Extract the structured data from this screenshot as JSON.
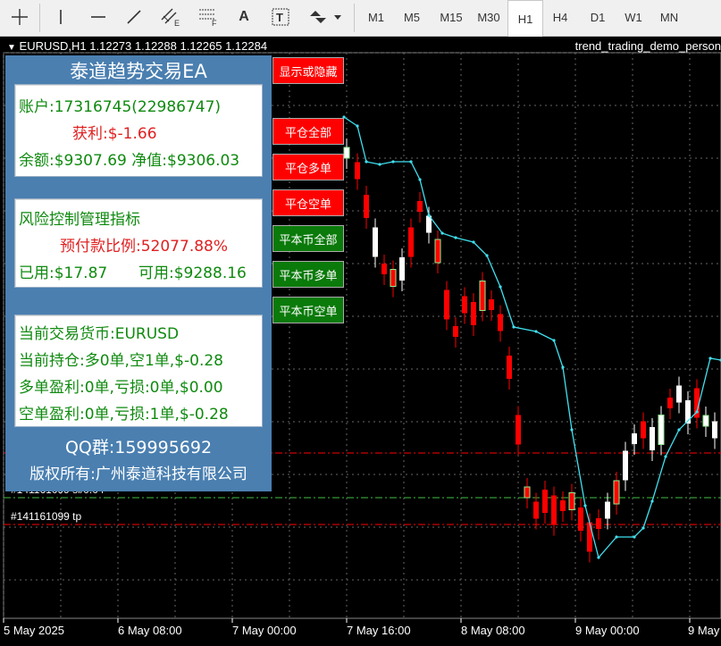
{
  "toolbar": {
    "timeframes": [
      "M1",
      "M5",
      "M15",
      "M30",
      "H1",
      "H4",
      "D1",
      "W1",
      "MN"
    ],
    "active_timeframe": "H1",
    "tool_text": "A",
    "tool_textbox": "T"
  },
  "chart": {
    "title": "EURUSD,H1  1.12273 1.12288 1.12265 1.12284",
    "ea_name": "trend_trading_demo_person",
    "sl_label": "#141161099 sl/0.04",
    "tp_label": "#141161099 tp",
    "x_labels": [
      "5 May 2025",
      "6 May 08:00",
      "7 May 00:00",
      "7 May 16:00",
      "8 May 08:00",
      "9 May 00:00",
      "9 May"
    ],
    "colors": {
      "bull": "#ffffff",
      "bear": "#ff0000",
      "doji": "#90ee90",
      "trail": "#40e0f0",
      "stop": "#ff0000",
      "grid": "#666666"
    }
  },
  "panel": {
    "title": "泰道趋势交易EA",
    "account_label": "账户:",
    "account_value": "17316745(22986747)",
    "profit_label": "获利:",
    "profit_value": "$-1.66",
    "balance_label": "余额:",
    "balance_value": "$9307.69",
    "equity_label": "净值:",
    "equity_value": "$9306.03",
    "risk_title": "风险控制管理指标",
    "margin_ratio_label": "预付款比例:",
    "margin_ratio_value": "52077.88%",
    "used_label": "已用:",
    "used_value": "$17.87",
    "free_label": "可用:",
    "free_value": "$9288.16",
    "symbol_label": "当前交易货币:",
    "symbol_value": "EURUSD",
    "pos_label": "当前持仓:",
    "pos_value": "多0单,空1单,$-0.28",
    "long_label": "多单盈利:",
    "long_value": "0单,亏损:0单,$0.00",
    "short_label": "空单盈利:",
    "short_value": "0单,亏损:1单,$-0.28",
    "qq": "QQ群:159995692",
    "copyright": "版权所有:广州泰道科技有限公司"
  },
  "buttons": {
    "toggle": "显示或隐藏",
    "close_all": "平仓全部",
    "close_long": "平仓多单",
    "close_short": "平仓空单",
    "be_all": "平本币全部",
    "be_long": "平本币多单",
    "be_short": "平本币空单"
  }
}
